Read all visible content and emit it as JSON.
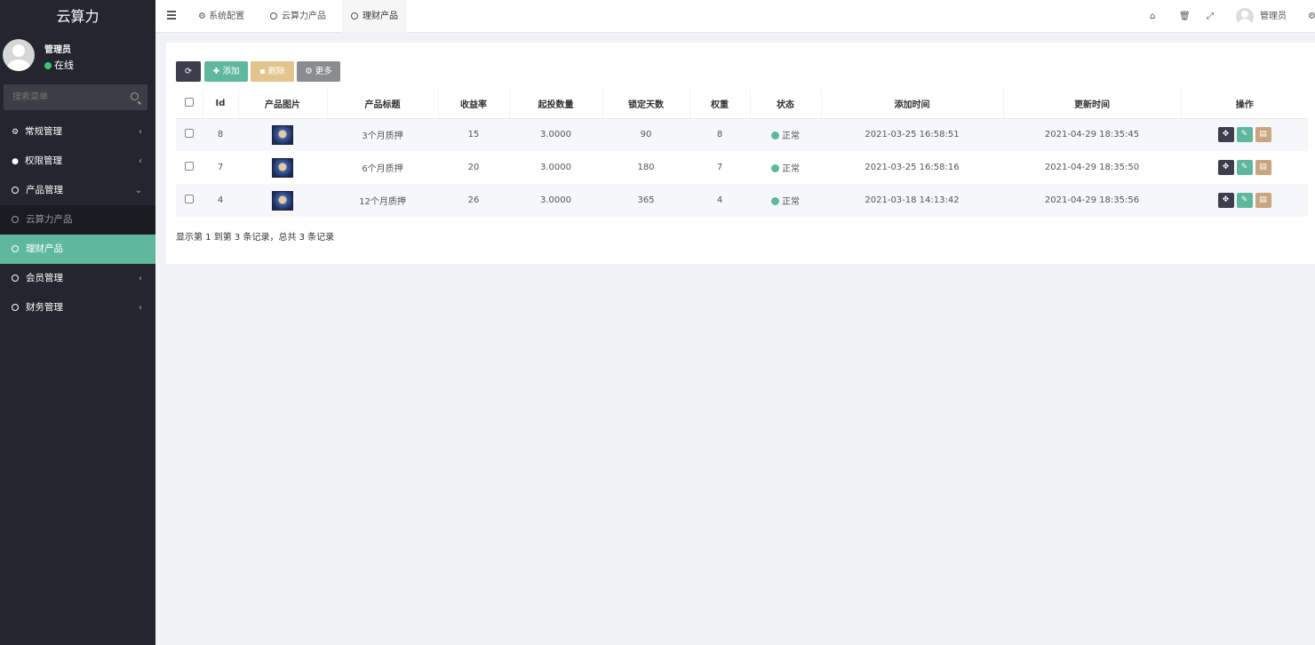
{
  "brand": "云算力",
  "user": {
    "name": "管理员",
    "status": "在线"
  },
  "search": {
    "placeholder": "搜索菜单"
  },
  "menu": [
    {
      "label": "常规管理",
      "icon": "cogs-icon",
      "arrow": "‹"
    },
    {
      "label": "权限管理",
      "icon": "group-icon",
      "arrow": "‹"
    },
    {
      "label": "产品管理",
      "icon": "circle-icon",
      "arrow": "⌄"
    },
    {
      "label": "云算力产品",
      "icon": "circle-icon"
    },
    {
      "label": "理财产品",
      "icon": "circle-icon"
    },
    {
      "label": "会员管理",
      "icon": "circle-icon",
      "arrow": "‹"
    },
    {
      "label": "财务管理",
      "icon": "circle-icon",
      "arrow": "‹"
    }
  ],
  "tabs": [
    {
      "label": "系统配置"
    },
    {
      "label": "云算力产品"
    },
    {
      "label": "理财产品"
    }
  ],
  "topright": {
    "user": "管理员"
  },
  "toolbar": {
    "add": "添加",
    "delete": "删除",
    "more": "更多"
  },
  "table": {
    "headers": [
      "Id",
      "产品图片",
      "产品标题",
      "收益率",
      "起投数量",
      "锁定天数",
      "权重",
      "状态",
      "添加时间",
      "更新时间",
      "操作"
    ],
    "rows": [
      {
        "id": "8",
        "title": "3个月质押",
        "rate": "15",
        "min": "3.0000",
        "days": "90",
        "weight": "8",
        "status": "正常",
        "created": "2021-03-25 16:58:51",
        "updated": "2021-04-29 18:35:45"
      },
      {
        "id": "7",
        "title": "6个月质押",
        "rate": "20",
        "min": "3.0000",
        "days": "180",
        "weight": "7",
        "status": "正常",
        "created": "2021-03-25 16:58:16",
        "updated": "2021-04-29 18:35:50"
      },
      {
        "id": "4",
        "title": "12个月质押",
        "rate": "26",
        "min": "3.0000",
        "days": "365",
        "weight": "4",
        "status": "正常",
        "created": "2021-03-18 14:13:42",
        "updated": "2021-04-29 18:35:56"
      }
    ]
  },
  "footer": "显示第 1 到第 3 条记录，总共 3 条记录",
  "colors": {
    "sidebar": "#23262e",
    "active": "#5fb89d",
    "delete": "#e4c48d",
    "refresh": "#3c3d4d"
  }
}
